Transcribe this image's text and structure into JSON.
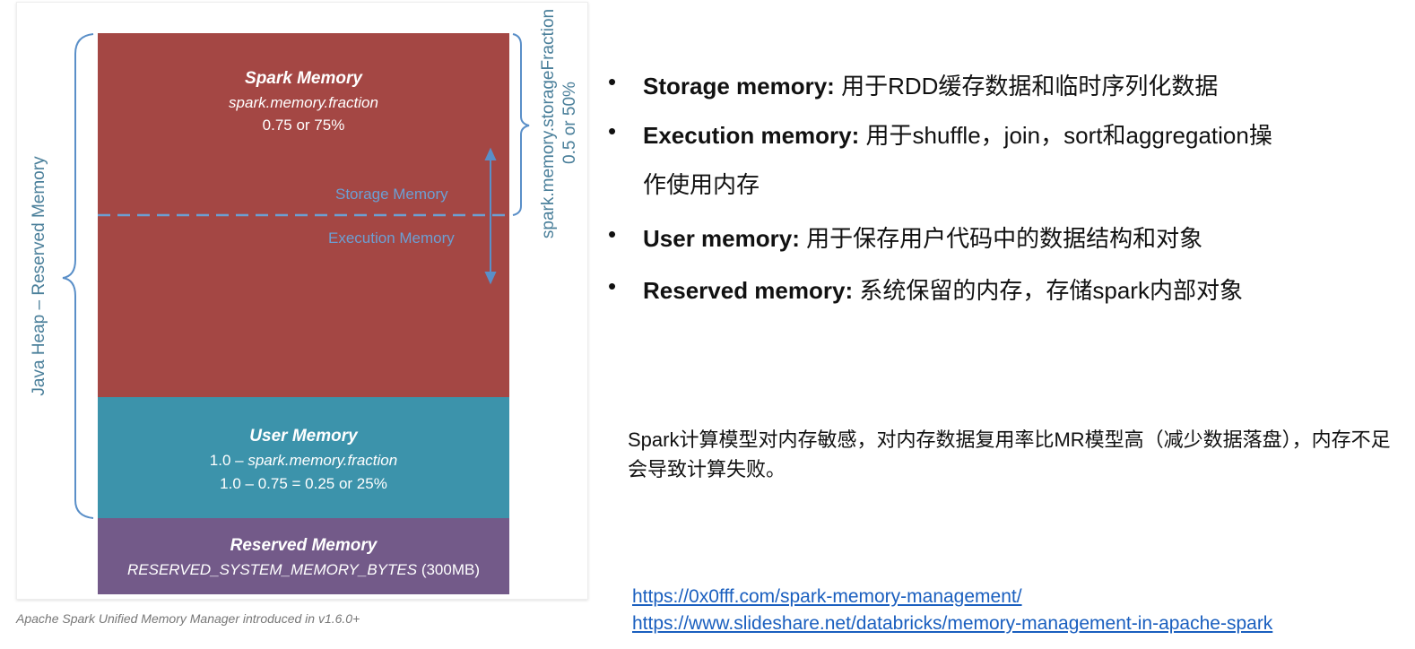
{
  "diagram": {
    "spark_memory": {
      "title": "Spark Memory",
      "param": "spark.memory.fraction",
      "value": "0.75 or 75%"
    },
    "storage_label": "Storage Memory",
    "execution_label": "Execution Memory",
    "user_memory": {
      "title": "User Memory",
      "param_prefix": "1.0 – ",
      "param": "spark.memory.fraction",
      "value": "1.0 – 0.75 = 0.25 or 25%"
    },
    "reserved_memory": {
      "title": "Reserved Memory",
      "param": "RESERVED_SYSTEM_MEMORY_BYTES",
      "value": "(300MB)"
    },
    "left_brace_label": "Java Heap – Reserved Memory",
    "right_brace_label": "spark.memory.storageFraction",
    "right_brace_value": "0.5 or 50%",
    "caption": "Apache Spark Unified Memory Manager introduced in v1.6.0+",
    "colors": {
      "spark": "#a44744",
      "user": "#3c93ab",
      "reserved": "#735a89",
      "annotation": "#6c9fd3"
    }
  },
  "bullets": [
    {
      "term": "Storage memory:",
      "desc": "用于RDD缓存数据和临时序列化数据"
    },
    {
      "term": "Execution memory:",
      "desc": "用于shuffle，join，sort和aggregation操",
      "desc2": "作使用内存"
    },
    {
      "term": "User memory:",
      "desc": "用于保存用户代码中的数据结构和对象"
    },
    {
      "term": "Reserved memory:",
      "desc": "系统保留的内存，存储spark内部对象"
    }
  ],
  "note": "Spark计算模型对内存敏感，对内存数据复用率比MR模型高（减少数据落盘），内存不足会导致计算失败。",
  "links": [
    "https://0x0fff.com/spark-memory-management/",
    "https://www.slideshare.net/databricks/memory-management-in-apache-spark"
  ]
}
